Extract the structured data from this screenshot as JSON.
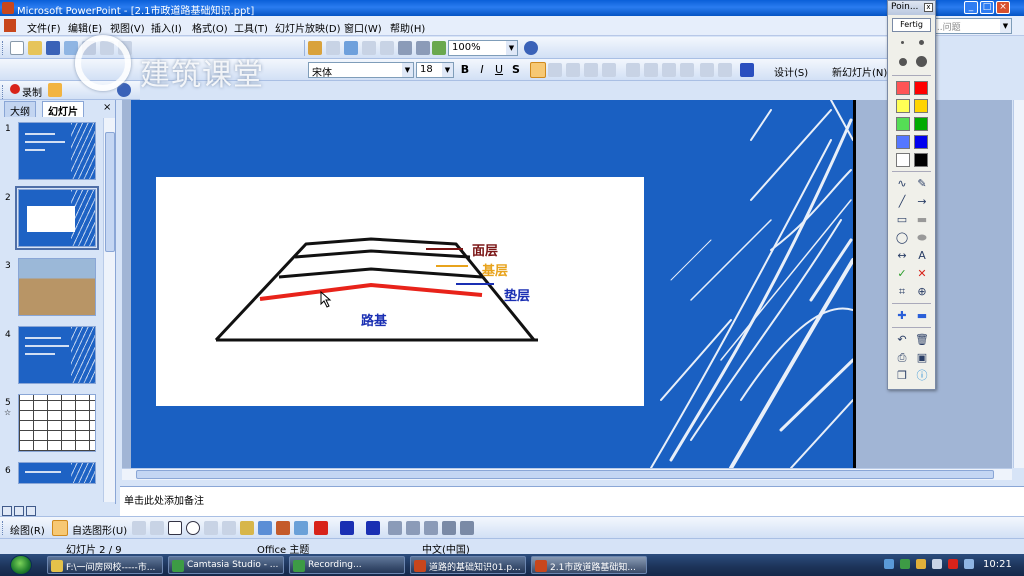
{
  "window": {
    "title": "Microsoft PowerPoint - [2.1市政道路基础知识.ppt]",
    "controls": [
      "_",
      "□",
      "×"
    ]
  },
  "menubar": {
    "items": [
      "文件(F)",
      "编辑(E)",
      "视图(V)",
      "插入(I)",
      "格式(O)",
      "工具(T)",
      "幻灯片放映(D)",
      "窗口(W)",
      "帮助(H)"
    ],
    "help_placeholder": "...问题"
  },
  "toolbar_standard": {
    "zoom": "100%"
  },
  "toolbar_format": {
    "font": "宋体",
    "font_size": "18",
    "bold": "B",
    "italic": "I",
    "underline": "U",
    "shadow": "S",
    "design": "设计(S)",
    "new_slide": "新幻灯片(N)"
  },
  "toolbar_review": {
    "record": "录制"
  },
  "watermark": "建筑课堂",
  "leftpane": {
    "tabs": [
      "大纲",
      "幻灯片"
    ],
    "close": "×",
    "slide_numbers": [
      "1",
      "2",
      "3",
      "4",
      "5",
      "6"
    ],
    "star": "☆"
  },
  "slide": {
    "labels": {
      "surface": "面层",
      "base": "基层",
      "cushion": "垫层",
      "subgrade": "路基"
    },
    "colors": {
      "background": "#1a60c2",
      "surface_line": "#7a1515",
      "base_line": "#e8a31c",
      "cushion_line": "#1a2fb3",
      "highlight": "#e8231a"
    }
  },
  "notes": {
    "placeholder": "单击此处添加备注"
  },
  "drawbar": {
    "draw": "绘图(R)",
    "autoshapes": "自选图形(U)"
  },
  "status": {
    "slide_indicator": "幻灯片 2 / 9",
    "theme": "Office 主题",
    "language": "中文(中国)"
  },
  "taskbar": {
    "tasks": [
      "F:\\一间房网校-----市...",
      "Camtasia Studio - ...",
      "Recording...",
      "道路的基础知识01.p...",
      "2.1市政道路基础知..."
    ],
    "clock": "10:21"
  },
  "pointer_palette": {
    "title": "Poin...",
    "done_button": "Fertig",
    "close": "x",
    "colors": [
      "#ff5555",
      "#ff0000",
      "#ffff55",
      "#ffd400",
      "#55dd55",
      "#00aa00",
      "#5577ff",
      "#0000ee",
      "#ffffff",
      "#000000"
    ],
    "text_tool": "A"
  }
}
